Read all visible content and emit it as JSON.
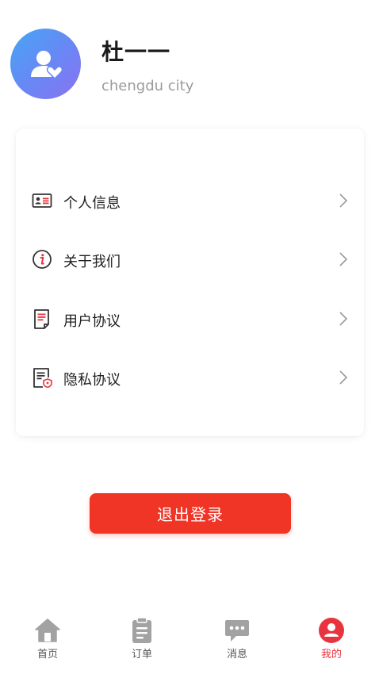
{
  "profile": {
    "name": "杜一一",
    "city": "chengdu city"
  },
  "menu": {
    "items": [
      {
        "label": "个人信息",
        "icon": "id-card-icon"
      },
      {
        "label": "关于我们",
        "icon": "info-icon"
      },
      {
        "label": "用户协议",
        "icon": "document-icon"
      },
      {
        "label": "隐私协议",
        "icon": "privacy-document-icon"
      }
    ]
  },
  "logout": {
    "label": "退出登录"
  },
  "tabbar": {
    "tabs": [
      {
        "label": "首页",
        "icon": "home-icon"
      },
      {
        "label": "订单",
        "icon": "clipboard-icon"
      },
      {
        "label": "消息",
        "icon": "chat-icon"
      },
      {
        "label": "我的",
        "icon": "user-icon",
        "active": true
      }
    ]
  },
  "colors": {
    "accent": "#f03426",
    "active_tab": "#e8343f",
    "avatar_gradient_start": "#46a6f3",
    "avatar_gradient_end": "#8b72f0"
  }
}
